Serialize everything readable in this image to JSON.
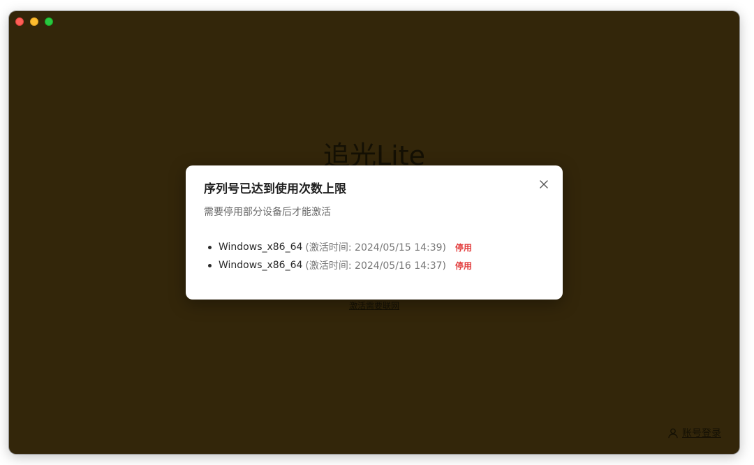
{
  "app": {
    "title": "追光Lite",
    "background_link": "激活需要联网",
    "login_label": "账号登录"
  },
  "dialog": {
    "title": "序列号已达到使用次数上限",
    "subtitle": "需要停用部分设备后才能激活",
    "devices": [
      {
        "name": "Windows_x86_64",
        "time": "(激活时间: 2024/05/15 14:39)",
        "action": "停用"
      },
      {
        "name": "Windows_x86_64",
        "time": "(激活时间: 2024/05/16 14:37)",
        "action": "停用"
      }
    ]
  },
  "colors": {
    "window_bg": "#33260a",
    "accent_red": "#e23b3b"
  },
  "icons": {
    "close": "close-icon",
    "user": "user-icon"
  }
}
